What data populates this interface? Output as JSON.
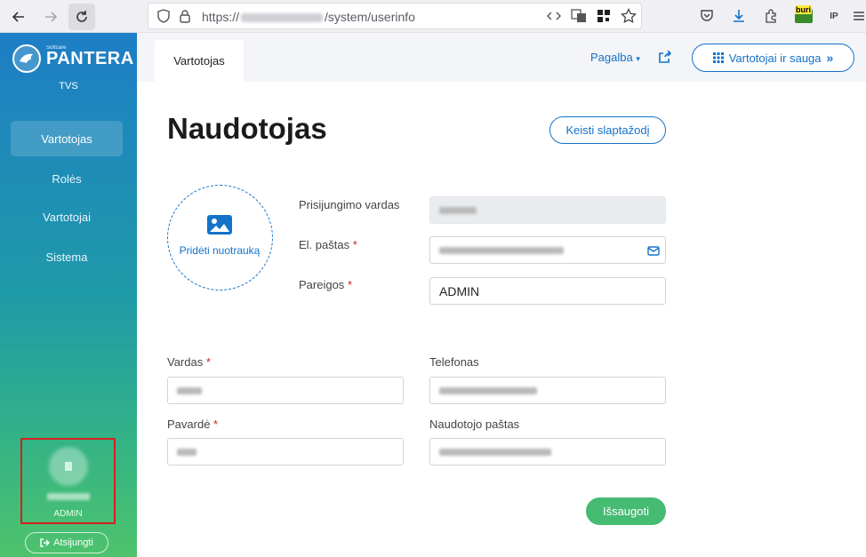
{
  "browser": {
    "url_prefix": "https://",
    "url_path": "/system/userinfo",
    "ext_badge": "buri",
    "ip_label": "IP"
  },
  "sidebar": {
    "logo_small": "Softcare",
    "logo_name": "PANTERA",
    "subtitle": "TVS",
    "items": [
      {
        "label": "Vartotojas"
      },
      {
        "label": "Rolės"
      },
      {
        "label": "Vartotojai"
      },
      {
        "label": "Sistema"
      }
    ],
    "user_role": "ADMIN",
    "logout_label": "Atsijungti"
  },
  "header": {
    "tab_label": "Vartotojas",
    "help_label": "Pagalba",
    "security_button": "Vartotojai ir sauga"
  },
  "main": {
    "title": "Naudotojas",
    "change_password": "Keisti slaptažodį",
    "add_photo": "Pridėti nuotrauką",
    "login_label": "Prisijungimo vardas",
    "email_label": "El. paštas",
    "position_label": "Pareigos",
    "position_value": "ADMIN",
    "first_name_label": "Vardas",
    "phone_label": "Telefonas",
    "last_name_label": "Pavardė",
    "user_email_label": "Naudotojo paštas",
    "required_mark": "*",
    "save_label": "Išsaugoti"
  },
  "colors": {
    "accent": "#1473c9",
    "save": "#46bb72",
    "required": "#d42020",
    "highlight_box": "#d42020"
  }
}
